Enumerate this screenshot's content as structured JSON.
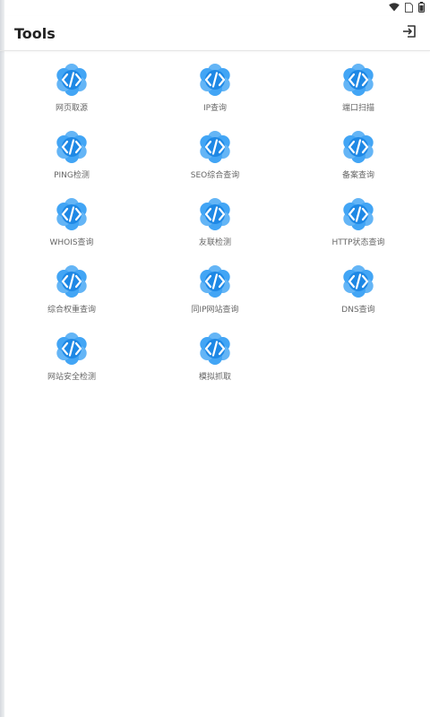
{
  "app": {
    "title": "Tools",
    "action_icon": "export-icon"
  },
  "status_bar": {
    "icons": [
      "wifi-icon",
      "sim-card-icon",
      "battery-icon"
    ]
  },
  "colors": {
    "accent": "#1e88e5",
    "accent_light": "#64b5f6",
    "title_text": "#222222",
    "label_text": "#666666"
  },
  "tools": [
    {
      "label": "网页取源",
      "icon": "code-flower-icon"
    },
    {
      "label": "IP查询",
      "icon": "code-flower-icon"
    },
    {
      "label": "端口扫描",
      "icon": "code-flower-icon"
    },
    {
      "label": "PING检测",
      "icon": "code-flower-icon"
    },
    {
      "label": "SEO综合查询",
      "icon": "code-flower-icon"
    },
    {
      "label": "备案查询",
      "icon": "code-flower-icon"
    },
    {
      "label": "WHOIS查询",
      "icon": "code-flower-icon"
    },
    {
      "label": "友联检测",
      "icon": "code-flower-icon"
    },
    {
      "label": "HTTP状态查询",
      "icon": "code-flower-icon"
    },
    {
      "label": "综合权重查询",
      "icon": "code-flower-icon"
    },
    {
      "label": "同IP网站查询",
      "icon": "code-flower-icon"
    },
    {
      "label": "DNS查询",
      "icon": "code-flower-icon"
    },
    {
      "label": "网站安全检测",
      "icon": "code-flower-icon"
    },
    {
      "label": "模拟抓取",
      "icon": "code-flower-icon"
    }
  ]
}
